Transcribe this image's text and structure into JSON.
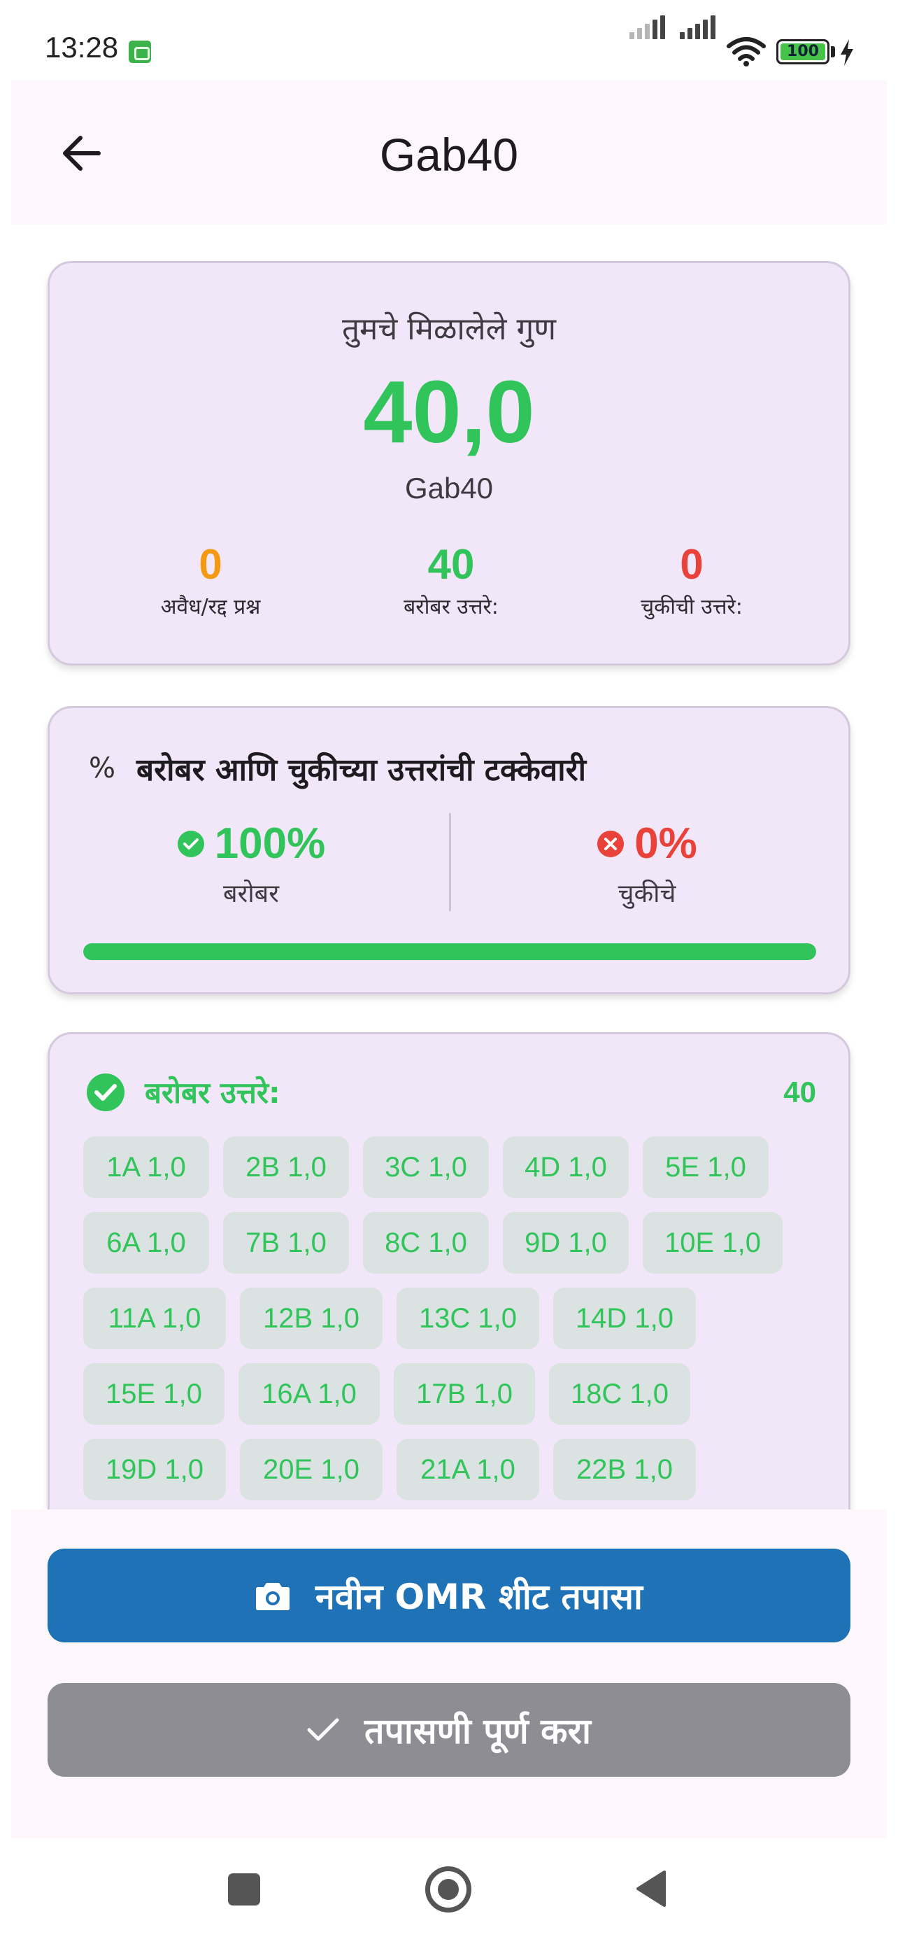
{
  "status_bar": {
    "time": "13:28",
    "battery": "100",
    "icons": [
      "app-notification-icon",
      "signal-icon",
      "signal-icon",
      "wifi-icon",
      "battery-icon",
      "charging-bolt-icon"
    ]
  },
  "app_bar": {
    "title": "Gab40",
    "back_icon": "arrow-left-icon"
  },
  "score_card": {
    "subtitle": "तुमचे मिळालेले गुण",
    "score": "40,0",
    "name": "Gab40",
    "stats": [
      {
        "value": "0",
        "label": "अवैध/रद्द प्रश्न",
        "color": "#f39a12"
      },
      {
        "value": "40",
        "label": "बरोबर उत्तरे:",
        "color": "#31c45b"
      },
      {
        "value": "0",
        "label": "चुकीची उत्तरे:",
        "color": "#e8423a"
      }
    ]
  },
  "percentage_card": {
    "icon": "percent-icon",
    "title": "बरोबर आणि चुकीच्या उत्तरांची टक्केवारी",
    "correct": {
      "value": "100%",
      "label": "बरोबर",
      "color": "#31c45b"
    },
    "wrong": {
      "value": "0%",
      "label": "चुकीचे",
      "color": "#e8423a"
    },
    "progress_correct_percent": 100
  },
  "answers_card": {
    "title": "बरोबर उत्तरे:",
    "count": "40",
    "rows": [
      [
        "1A 1,0",
        "2B 1,0",
        "3C 1,0",
        "4D 1,0",
        "5E 1,0"
      ],
      [
        "6A 1,0",
        "7B 1,0",
        "8C 1,0",
        "9D 1,0",
        "10E 1,0"
      ],
      [
        "11A 1,0",
        "12B 1,0",
        "13C 1,0",
        "14D 1,0"
      ],
      [
        "15E 1,0",
        "16A 1,0",
        "17B 1,0",
        "18C 1,0"
      ],
      [
        "19D 1,0",
        "20E 1,0",
        "21A 1,0",
        "22B 1,0"
      ],
      [
        "",
        "",
        "",
        ""
      ]
    ]
  },
  "actions": {
    "primary_label": "नवीन OMR शीट तपासा",
    "primary_color": "#1e72b5",
    "secondary_label": "तपासणी पूर्ण करा",
    "secondary_color": "#8d8d93"
  },
  "colors": {
    "success": "#31c45b",
    "error": "#e8423a",
    "warning": "#f39a12",
    "card_bg": "#f2e7f8"
  }
}
